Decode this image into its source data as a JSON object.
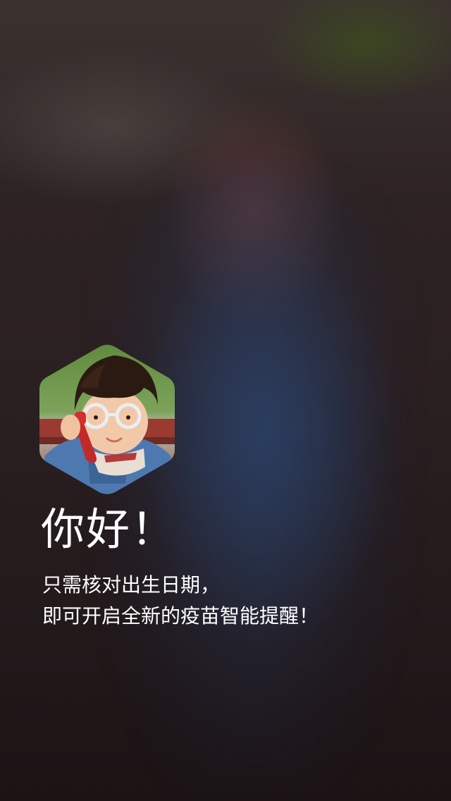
{
  "background": {
    "image": "blurred-child-photo"
  },
  "avatar": {
    "image": "child-talking-on-red-phone-with-glasses",
    "shape": "hexagon"
  },
  "greeting": "你好！",
  "subtitle": {
    "line1": "只需核对出生日期，",
    "line2": "即可开启全新的疫苗智能提醒！"
  },
  "colors": {
    "text": "#ffffff",
    "background": "#2a1f21"
  }
}
